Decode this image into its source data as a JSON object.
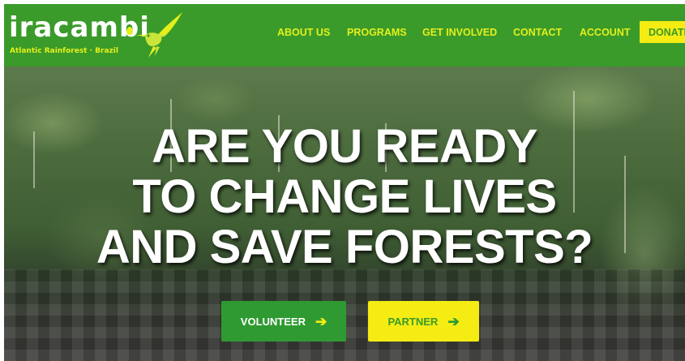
{
  "logo": {
    "word": "iracambi",
    "tagline": "Atlantic Rainforest · Brazil"
  },
  "nav": {
    "items": [
      "ABOUT US",
      "PROGRAMS",
      "GET INVOLVED",
      "CONTACT",
      "ACCOUNT"
    ],
    "donate": "DONATE"
  },
  "hero": {
    "headline": [
      "ARE YOU READY",
      "TO CHANGE LIVES",
      "AND SAVE FORESTS?"
    ],
    "buttons": {
      "volunteer": "VOLUNTEER",
      "partner": "PARTNER"
    }
  },
  "colors": {
    "brand_green": "#3a9b2a",
    "accent_yellow": "#f4ec13",
    "nav_text": "#e4ef1c",
    "button_green": "#2f9a31"
  },
  "icons": {
    "logo_mark": "hummingbird-icon",
    "button_arrow": "arrow-right-icon"
  }
}
